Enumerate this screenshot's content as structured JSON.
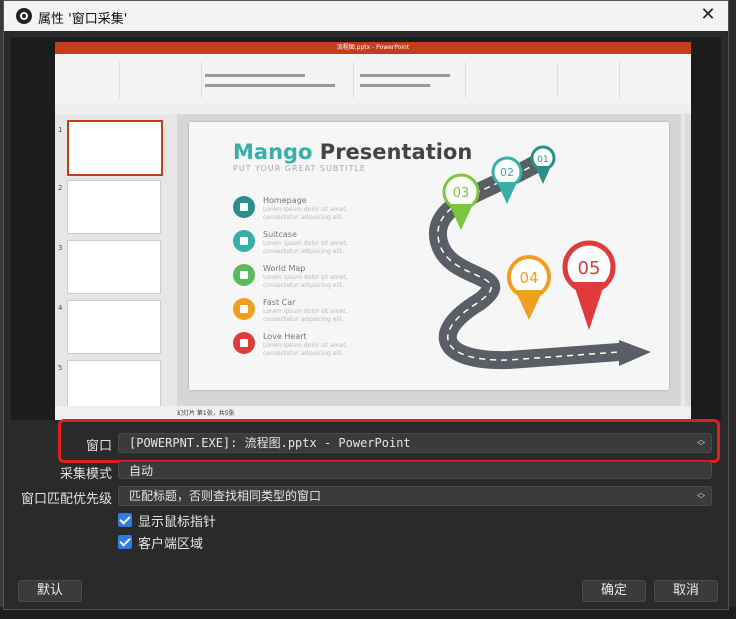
{
  "window": {
    "title": "属性 '窗口采集'"
  },
  "preview": {
    "app_title": "流程图.pptx - PowerPoint",
    "slide_title_part1": "Mango",
    "slide_title_part2": "Presentation",
    "slide_subtitle": "PUT YOUR GREAT SUBTITLE",
    "items": [
      {
        "label": "Homepage",
        "color": "#2a8f8a"
      },
      {
        "label": "Suitcase",
        "color": "#38b0a7"
      },
      {
        "label": "World Map",
        "color": "#5cb85c"
      },
      {
        "label": "Fast Car",
        "color": "#f0a020"
      },
      {
        "label": "Love Heart",
        "color": "#e03a3a"
      }
    ],
    "item_desc": "Lorem ipsum dolor sit amet, consectetur adipiscing elit.",
    "pins": [
      {
        "label": "01",
        "color": "#2a8f8a"
      },
      {
        "label": "02",
        "color": "#38b0a7"
      },
      {
        "label": "03",
        "color": "#7cc63f"
      },
      {
        "label": "04",
        "color": "#f0a020"
      },
      {
        "label": "05",
        "color": "#e03a3a"
      }
    ],
    "status_text": "幻灯片 第1张，共5张",
    "thumb_numbers": [
      "1",
      "2",
      "3",
      "4",
      "5"
    ]
  },
  "form": {
    "window_label": "窗口",
    "window_value": "[POWERPNT.EXE]: 流程图.pptx - PowerPoint",
    "capture_mode_label": "采集模式",
    "capture_mode_value": "自动",
    "priority_label": "窗口匹配优先级",
    "priority_value": "匹配标题，否则查找相同类型的窗口",
    "show_cursor_label": "显示鼠标指针",
    "client_area_label": "客户端区域"
  },
  "buttons": {
    "defaults": "默认",
    "ok": "确定",
    "cancel": "取消"
  },
  "colors": {
    "highlight": "#e02020",
    "checkbox": "#2f7ce0",
    "accent_ppt": "#c43e1c"
  }
}
